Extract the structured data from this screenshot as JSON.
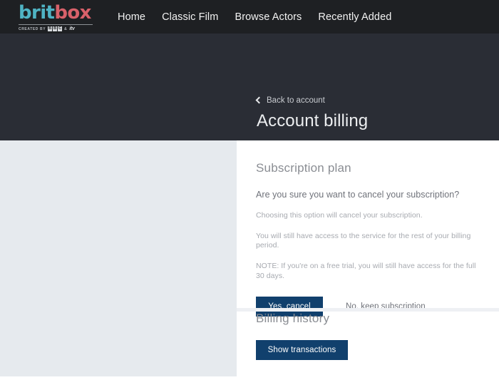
{
  "brand": {
    "logo_brit": "brit",
    "logo_box": "box",
    "logo_created_by": "CREATED BY",
    "logo_bbc_letters": [
      "B",
      "B",
      "C"
    ],
    "logo_amp": "&",
    "logo_itv": "itv",
    "teal": "#4fb3c4",
    "coral": "#d8616a",
    "nav_bg": "#1e2023",
    "hero_bg": "#2a2d35",
    "panel_bg": "#e6eaee",
    "accent_button": "#11406d"
  },
  "nav": {
    "items": [
      {
        "label": "Home"
      },
      {
        "label": "Classic Film"
      },
      {
        "label": "Browse Actors"
      },
      {
        "label": "Recently Added"
      }
    ]
  },
  "hero": {
    "back_icon": "chevron-left-icon",
    "back_label": "Back to account",
    "title": "Account billing"
  },
  "subscription": {
    "title": "Subscription plan",
    "question": "Are you sure you want to cancel your subscription?",
    "paragraphs": [
      "Choosing this option will cancel your subscription.",
      "You will still have access to the service for the rest of your billing period.",
      "NOTE: If you're on a free trial, you will still have access for the full 30 days."
    ],
    "confirm_label": "Yes, cancel",
    "decline_label": "No, keep subscription"
  },
  "billing_history": {
    "title": "Billing history",
    "show_label": "Show transactions"
  }
}
